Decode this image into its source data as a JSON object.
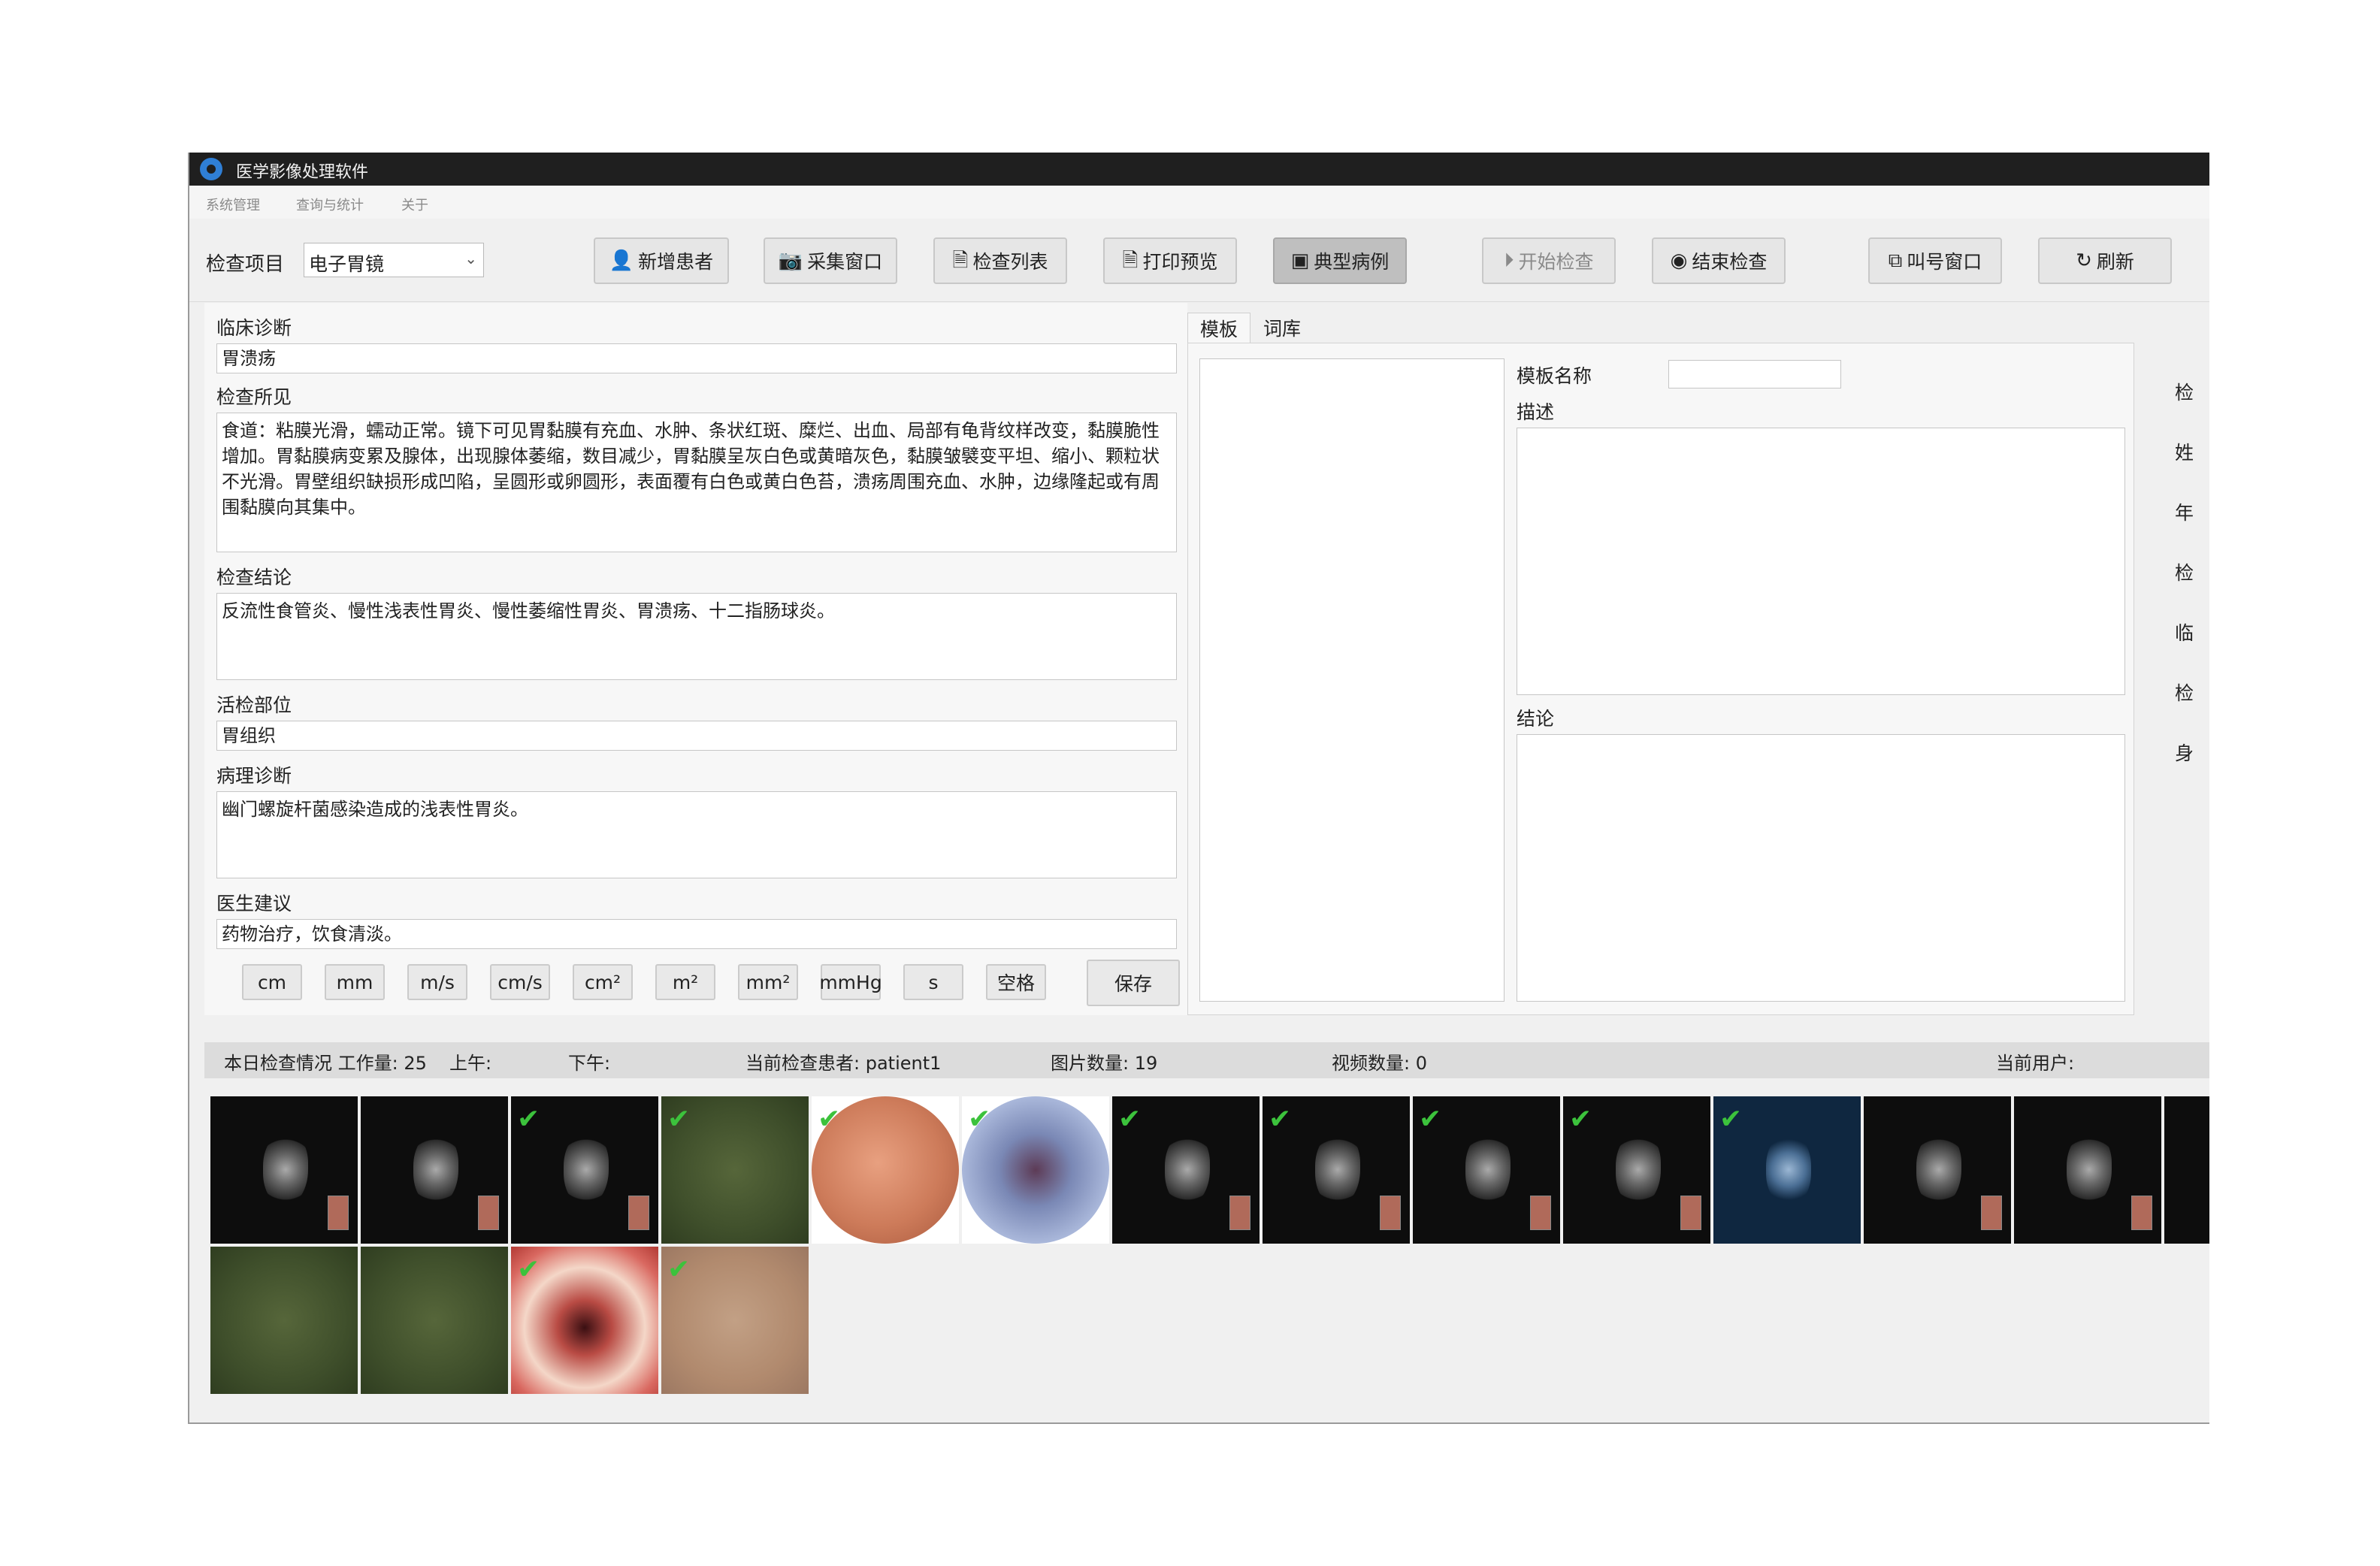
{
  "app": {
    "title": "医学影像处理软件"
  },
  "menu": [
    "系统管理",
    "查询与统计",
    "关于"
  ],
  "toolbar": {
    "exam_item_label": "检查项目",
    "exam_item_value": "电子胃镜",
    "buttons": [
      "新增患者",
      "采集窗口",
      "检查列表",
      "打印预览",
      "典型病例",
      "开始检查",
      "结束检查",
      "叫号窗口",
      "刷新"
    ]
  },
  "form": {
    "clinical_diagnosis_label": "临床诊断",
    "clinical_diagnosis": "胃溃疡",
    "findings_label": "检查所见",
    "findings": "食道：粘膜光滑，蠕动正常。镜下可见胃黏膜有充血、水肿、条状红斑、糜烂、出血、局部有龟背纹样改变，黏膜脆性增加。胃黏膜病变累及腺体，出现腺体萎缩，数目减少，胃黏膜呈灰白色或黄暗灰色，黏膜皱襞变平坦、缩小、颗粒状不光滑。胃壁组织缺损形成凹陷，呈圆形或卵圆形，表面覆有白色或黄白色苔，溃疡周围充血、水肿，边缘隆起或有周围黏膜向其集中。",
    "conclusion_label": "检查结论",
    "conclusion": "反流性食管炎、慢性浅表性胃炎、慢性萎缩性胃炎、胃溃疡、十二指肠球炎。",
    "biopsy_label": "活检部位",
    "biopsy": "胃组织",
    "pathology_label": "病理诊断",
    "pathology": "幽门螺旋杆菌感染造成的浅表性胃炎。",
    "advice_label": "医生建议",
    "advice": "药物治疗，饮食清淡。",
    "units": [
      "cm",
      "mm",
      "m/s",
      "cm/s",
      "cm²",
      "m²",
      "mm²",
      "mmHg",
      "s",
      "空格"
    ],
    "save": "保存"
  },
  "template_panel": {
    "tabs": [
      "模板",
      "词库"
    ],
    "name_label": "模板名称",
    "name_value": "",
    "desc_label": "描述",
    "conclusion_label": "结论"
  },
  "right_labels": [
    "检",
    "姓",
    "年",
    "检",
    "临",
    "检",
    "身"
  ],
  "status": {
    "today": "本日检查情况 工作量: 25",
    "am": "上午:",
    "pm": "下午:",
    "patient": "当前检查患者: patient1",
    "images": "图片数量: 19",
    "videos": "视频数量: 0",
    "user": "当前用户:"
  },
  "thumbnails_row1": [
    {
      "type": "us",
      "checked": false
    },
    {
      "type": "us",
      "checked": false
    },
    {
      "type": "us",
      "checked": true
    },
    {
      "type": "green",
      "checked": true
    },
    {
      "type": "orange",
      "checked": true
    },
    {
      "type": "purple",
      "checked": true
    },
    {
      "type": "us",
      "checked": true
    },
    {
      "type": "us",
      "checked": true
    },
    {
      "type": "us",
      "checked": true
    },
    {
      "type": "us",
      "checked": true
    },
    {
      "type": "blue",
      "checked": true
    },
    {
      "type": "us",
      "checked": false
    },
    {
      "type": "us",
      "checked": false
    },
    {
      "type": "us",
      "checked": false
    }
  ],
  "thumbnails_row2": [
    {
      "type": "green",
      "checked": false
    },
    {
      "type": "green",
      "checked": false
    },
    {
      "type": "red",
      "checked": true
    },
    {
      "type": "tan",
      "checked": true
    }
  ]
}
